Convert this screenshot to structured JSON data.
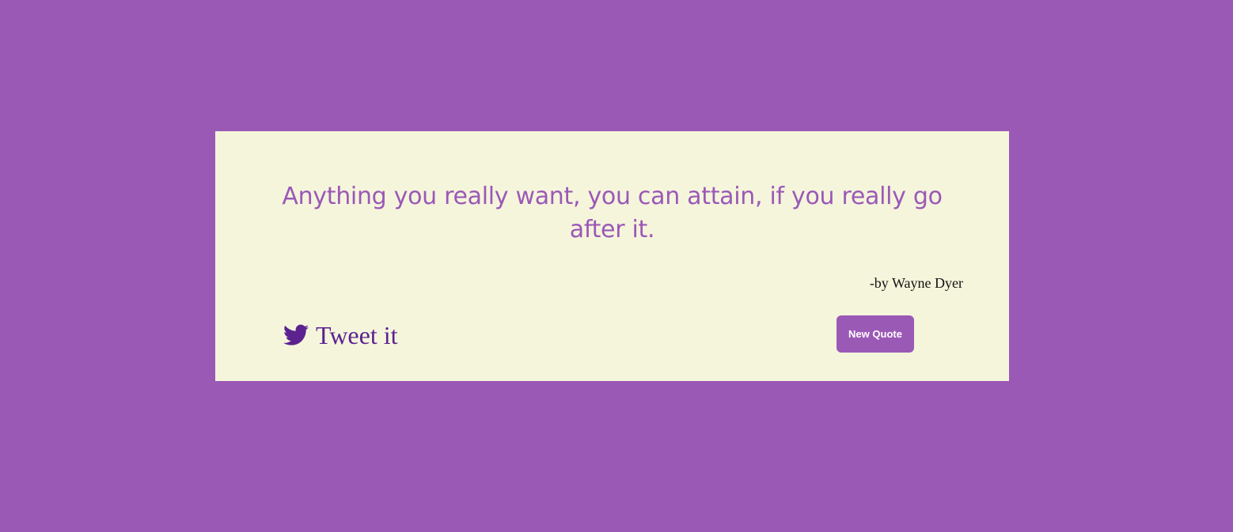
{
  "colors": {
    "background": "#9b59b6",
    "card": "#f5f5dc",
    "quote_text": "#9b59b6",
    "tweet": "#5b2290",
    "button": "#9b59b6",
    "button_text": "#ffffff"
  },
  "quote": {
    "text": "Anything you really want, you can attain, if you really go after it.",
    "author": "-by Wayne Dyer"
  },
  "actions": {
    "tweet_icon": "twitter-bird-icon",
    "tweet_label": "Tweet it",
    "new_quote_label": "New Quote"
  }
}
